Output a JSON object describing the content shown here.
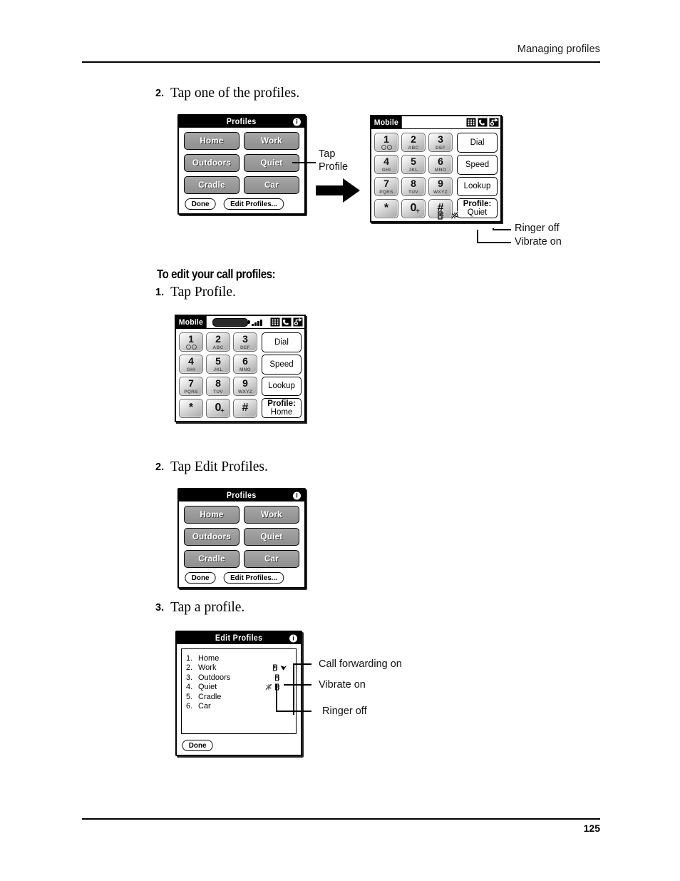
{
  "header": {
    "running_head": "Managing profiles"
  },
  "footer": {
    "page_number": "125"
  },
  "steps": {
    "s2_top_num": "2.",
    "s2_top_text": "Tap one of the profiles.",
    "subhead": "To edit your call profiles:",
    "s1_num": "1.",
    "s1_text": "Tap Profile.",
    "s2_num": "2.",
    "s2_text": "Tap Edit Profiles.",
    "s3_num": "3.",
    "s3_text": "Tap a profile."
  },
  "callouts": {
    "tap_profile_line1": "Tap",
    "tap_profile_line2": "Profile",
    "ringer_off": "Ringer off",
    "vibrate_on": "Vibrate on",
    "call_forwarding_on": "Call forwarding on",
    "vibrate_on_2": "Vibrate on",
    "ringer_off_2": "Ringer off"
  },
  "profiles_dialog_top": {
    "title": "Profiles",
    "info_glyph": "i",
    "buttons": [
      [
        "Home",
        "Work"
      ],
      [
        "Outdoors",
        "Quiet"
      ],
      [
        "Cradle",
        "Car"
      ]
    ],
    "done_label": "Done",
    "edit_profiles_label": "Edit Profiles..."
  },
  "profiles_dialog_mid": {
    "title": "Profiles",
    "info_glyph": "i",
    "buttons": [
      [
        "Home",
        "Work"
      ],
      [
        "Outdoors",
        "Quiet"
      ],
      [
        "Cradle",
        "Car"
      ]
    ],
    "done_label": "Done",
    "edit_profiles_label": "Edit Profiles..."
  },
  "phone_quiet": {
    "titlebar_label": "Mobile",
    "has_battery": false,
    "keys": [
      {
        "digit": "1",
        "letters": "",
        "voicemail": true
      },
      {
        "digit": "2",
        "letters": "ABC"
      },
      {
        "digit": "3",
        "letters": "DEF"
      },
      {
        "digit": "4",
        "letters": "GHI"
      },
      {
        "digit": "5",
        "letters": "JKL"
      },
      {
        "digit": "6",
        "letters": "MNO"
      },
      {
        "digit": "7",
        "letters": "PQRS"
      },
      {
        "digit": "8",
        "letters": "TUV"
      },
      {
        "digit": "9",
        "letters": "WXYZ"
      },
      {
        "digit": "*",
        "letters": ""
      },
      {
        "digit": "0",
        "letters": "",
        "plus": "+"
      },
      {
        "digit": "#",
        "letters": ""
      }
    ],
    "side_buttons": [
      {
        "line1": "Dial",
        "line2": ""
      },
      {
        "line1": "Speed",
        "line2": ""
      },
      {
        "line1": "Lookup",
        "line2": ""
      },
      {
        "line1": "Profile:",
        "line2": "Quiet"
      }
    ],
    "status_icons": [
      "vibrate-icon",
      "ringer-off-icon"
    ]
  },
  "phone_home": {
    "titlebar_label": "Mobile",
    "has_battery": true,
    "keys": [
      {
        "digit": "1",
        "letters": "",
        "voicemail": true
      },
      {
        "digit": "2",
        "letters": "ABC"
      },
      {
        "digit": "3",
        "letters": "DEF"
      },
      {
        "digit": "4",
        "letters": "GHI"
      },
      {
        "digit": "5",
        "letters": "JKL"
      },
      {
        "digit": "6",
        "letters": "MNO"
      },
      {
        "digit": "7",
        "letters": "PQRS"
      },
      {
        "digit": "8",
        "letters": "TUV"
      },
      {
        "digit": "9",
        "letters": "WXYZ"
      },
      {
        "digit": "*",
        "letters": ""
      },
      {
        "digit": "0",
        "letters": "",
        "plus": "+"
      },
      {
        "digit": "#",
        "letters": ""
      }
    ],
    "side_buttons": [
      {
        "line1": "Dial",
        "line2": ""
      },
      {
        "line1": "Speed",
        "line2": ""
      },
      {
        "line1": "Lookup",
        "line2": ""
      },
      {
        "line1": "Profile:",
        "line2": "Home"
      }
    ],
    "status_icons": []
  },
  "edit_profiles_dialog": {
    "title": "Edit Profiles",
    "info_glyph": "i",
    "rows": [
      {
        "index": "1.",
        "name": "Home",
        "icons": []
      },
      {
        "index": "2.",
        "name": "Work",
        "icons": [
          "vibrate-icon",
          "call-forward-icon"
        ]
      },
      {
        "index": "3.",
        "name": "Outdoors",
        "icons": [
          "vibrate-icon"
        ]
      },
      {
        "index": "4.",
        "name": "Quiet",
        "icons": [
          "ringer-off-icon",
          "vibrate-icon"
        ]
      },
      {
        "index": "5.",
        "name": "Cradle",
        "icons": []
      },
      {
        "index": "6.",
        "name": "Car",
        "icons": []
      }
    ],
    "done_label": "Done"
  },
  "colors": {
    "ink": "#000000",
    "profile_button_fill": "#9a9a9a",
    "key_fill_light": "#ffffff",
    "key_fill_dark": "#a7a7a7",
    "titlebar": "#000000"
  }
}
